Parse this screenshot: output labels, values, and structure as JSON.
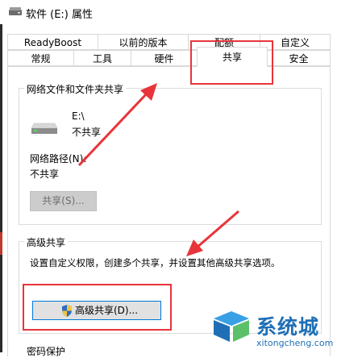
{
  "window": {
    "title": "软件 (E:) 属性"
  },
  "tabs_row1": [
    "ReadyBoost",
    "以前的版本",
    "配额",
    "自定义"
  ],
  "tabs_row2": [
    "常规",
    "工具",
    "硬件",
    "共享",
    "安全"
  ],
  "active_tab": "共享",
  "network_sharing": {
    "group_title": "网络文件和文件夹共享",
    "drive_name": "E:\\",
    "drive_status": "不共享",
    "path_label": "网络路径(N):",
    "path_value": "不共享",
    "share_button": "共享(S)..."
  },
  "advanced_sharing": {
    "group_title": "高级共享",
    "description": "设置自定义权限，创建多个共享，并设置其他高级共享选项。",
    "button": "高级共享(D)..."
  },
  "next_group_title": "密码保护",
  "watermark": {
    "brand": "系统城",
    "url": "xitongcheng.com"
  },
  "colors": {
    "highlight": "#e8343a",
    "focus_border": "#0078d7",
    "watermark": "#1f6fb6"
  }
}
